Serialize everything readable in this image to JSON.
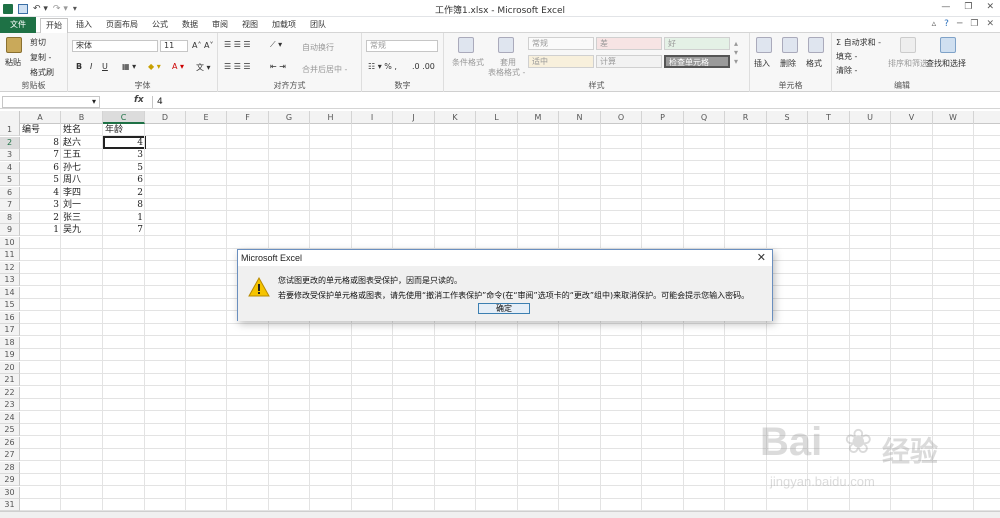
{
  "titlebar": {
    "doc_title": "工作簿1.xlsx - Microsoft Excel"
  },
  "tabs": [
    "文件",
    "开始",
    "插入",
    "页面布局",
    "公式",
    "数据",
    "审阅",
    "视图",
    "加载项",
    "团队"
  ],
  "ribbon": {
    "clipboard": {
      "paste": "粘贴",
      "cut": "剪切",
      "copy": "复制 -",
      "format_painter": "格式刷",
      "label": "剪贴板"
    },
    "font": {
      "font_name": "宋体",
      "font_size": "11",
      "label": "字体"
    },
    "alignment": {
      "wrap": "自动换行",
      "merge": "合并后居中 -",
      "label": "对齐方式"
    },
    "number": {
      "format": "常规",
      "label": "数字"
    },
    "styles": {
      "cond_format": "条件格式",
      "table_format": "套用",
      "table_format2": "表格格式 -",
      "cells": [
        "常规",
        "差",
        "好",
        "适中",
        "计算",
        "检查单元格"
      ],
      "label": "样式"
    },
    "cells_group": {
      "insert": "插入",
      "delete": "删除",
      "format": "格式",
      "label": "单元格"
    },
    "editing": {
      "autosum": "Σ 自动求和 -",
      "fill": "填充 -",
      "clear": "清除 -",
      "sort": "排序和筛选",
      "find": "查找和选择",
      "label": "编辑"
    }
  },
  "formula_bar": {
    "fx": "fx",
    "value": "4"
  },
  "columns": [
    "A",
    "B",
    "C",
    "D",
    "E",
    "F",
    "G",
    "H",
    "I",
    "J",
    "K",
    "L",
    "M",
    "N",
    "O",
    "P",
    "Q",
    "R",
    "S",
    "T",
    "U",
    "V",
    "W"
  ],
  "rows": [
    {
      "n": "1",
      "a": "编号",
      "b": "姓名",
      "c": "年龄"
    },
    {
      "n": "2",
      "a": "8",
      "b": "赵六",
      "c": "4"
    },
    {
      "n": "3",
      "a": "7",
      "b": "王五",
      "c": "3"
    },
    {
      "n": "4",
      "a": "6",
      "b": "孙七",
      "c": "5"
    },
    {
      "n": "5",
      "a": "5",
      "b": "周八",
      "c": "6"
    },
    {
      "n": "6",
      "a": "4",
      "b": "李四",
      "c": "2"
    },
    {
      "n": "7",
      "a": "3",
      "b": "刘一",
      "c": "8"
    },
    {
      "n": "8",
      "a": "2",
      "b": "张三",
      "c": "1"
    },
    {
      "n": "9",
      "a": "1",
      "b": "吴九",
      "c": "7"
    },
    {
      "n": "10"
    },
    {
      "n": "11"
    },
    {
      "n": "12"
    },
    {
      "n": "13"
    },
    {
      "n": "14"
    },
    {
      "n": "15"
    },
    {
      "n": "16"
    },
    {
      "n": "17"
    },
    {
      "n": "18"
    },
    {
      "n": "19"
    },
    {
      "n": "20"
    },
    {
      "n": "21"
    },
    {
      "n": "22"
    },
    {
      "n": "23"
    },
    {
      "n": "24"
    },
    {
      "n": "25"
    },
    {
      "n": "26"
    },
    {
      "n": "27"
    },
    {
      "n": "28"
    },
    {
      "n": "29"
    },
    {
      "n": "30"
    },
    {
      "n": "31"
    }
  ],
  "dialog": {
    "title": "Microsoft Excel",
    "line1": "您试图更改的单元格或图表受保护，因而是只读的。",
    "line2": "若要修改受保护单元格或图表，请先使用“撤消工作表保护”命令(在“审阅”选项卡的“更改”组中)来取消保护。可能会提示您输入密码。",
    "ok": "确定"
  },
  "watermark": {
    "brand": "Bai",
    "brand2": "经验",
    "url": "jingyan.baidu.com"
  },
  "colors": {
    "excel_green": "#1e7145",
    "warn_yellow": "#f5c400"
  }
}
